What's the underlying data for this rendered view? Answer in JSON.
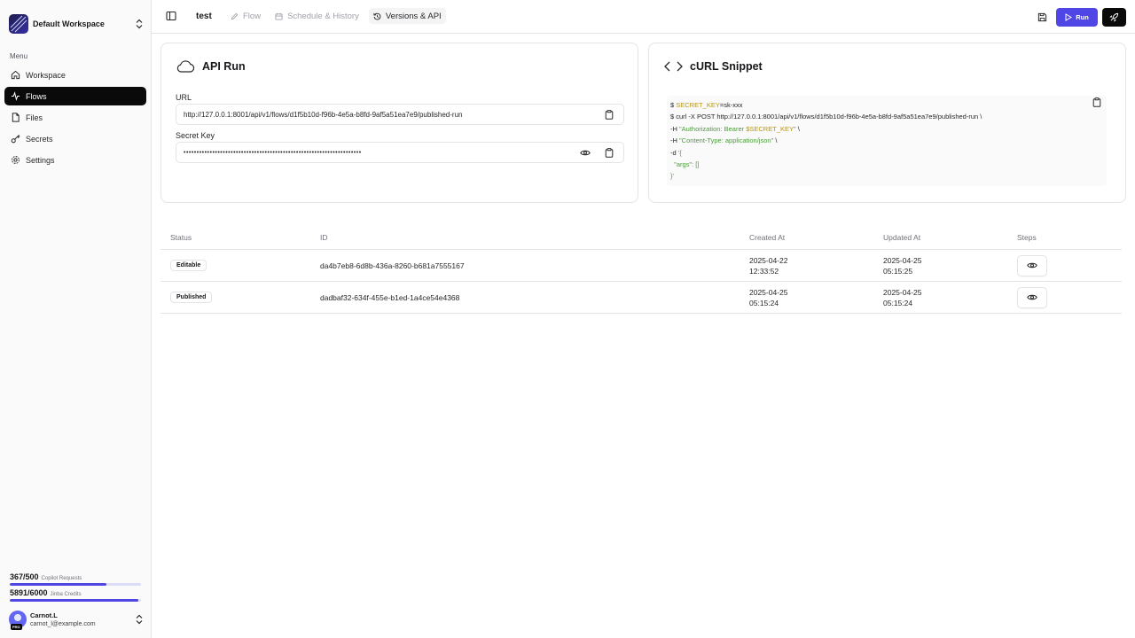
{
  "workspace": {
    "name": "Default Workspace"
  },
  "sidebar": {
    "menu_label": "Menu",
    "items": [
      {
        "label": "Workspace",
        "icon": "home-icon"
      },
      {
        "label": "Flows",
        "icon": "activity-icon",
        "active": true
      },
      {
        "label": "Files",
        "icon": "file-icon"
      },
      {
        "label": "Secrets",
        "icon": "key-icon"
      },
      {
        "label": "Settings",
        "icon": "gear-icon"
      }
    ],
    "usage": [
      {
        "value": "367/500",
        "label": "Copilot Requests",
        "fraction": 0.734
      },
      {
        "value": "5891/6000",
        "label": "Jinba Credits",
        "fraction": 0.982
      }
    ],
    "user": {
      "name": "Carnot.L",
      "email": "carnot_l@example.com",
      "badge": "PRO"
    }
  },
  "header": {
    "title": "test",
    "tabs": [
      {
        "label": "Flow",
        "icon": "pencil-icon"
      },
      {
        "label": "Schedule & History",
        "icon": "calendar-icon"
      },
      {
        "label": "Versions & API",
        "icon": "history-icon",
        "active": true
      }
    ],
    "run_label": "Run"
  },
  "api_card": {
    "title": "API Run",
    "url_label": "URL",
    "url_value": "http://127.0.0.1:8001/api/v1/flows/d1f5b10d-f96b-4e5a-b8fd-9af5a51ea7e9/published-run",
    "secret_label": "Secret Key",
    "secret_value": "••••••••••••••••••••••••••••••••••••••••••••••••••••••••••••••••••••"
  },
  "curl_card": {
    "title": "cURL Snippet",
    "lines": {
      "l1_prefix": "$ ",
      "l1_key": "SECRET_KEY",
      "l1_rest": "=sk-xxx",
      "l2": "$ curl -X POST http://127.0.0.1:8001/api/v1/flows/d1f5b10d-f96b-4e5a-b8fd-9af5a51ea7e9/published-run \\",
      "l3_prefix": "-H ",
      "l3_str": "\"Authorization: Bearer ",
      "l3_var": "$SECRET_KEY",
      "l3_end": "\"",
      "l3_tail": " \\",
      "l4_prefix": "-H ",
      "l4_str": "\"Content-Type: application/json\"",
      "l4_tail": " \\",
      "l5_prefix": "-d ",
      "l5_str": "'{",
      "l6_key": "\"args\"",
      "l6_rest": ": []",
      "l7": "}'"
    }
  },
  "versions_table": {
    "headers": {
      "status": "Status",
      "id": "ID",
      "created": "Created At",
      "updated": "Updated At",
      "steps": "Steps"
    },
    "rows": [
      {
        "status": "Editable",
        "id": "da4b7eb8-6d8b-436a-8260-b681a7555167",
        "created_date": "2025-04-22",
        "created_time": "12:33:52",
        "updated_date": "2025-04-25",
        "updated_time": "05:15:25"
      },
      {
        "status": "Published",
        "id": "dadbaf32-634f-455e-b1ed-1a4ce54e4368",
        "created_date": "2025-04-25",
        "created_time": "05:15:24",
        "updated_date": "2025-04-25",
        "updated_time": "05:15:24"
      }
    ]
  },
  "colors": {
    "accent": "#4f46e5",
    "dark": "#0a0a0a",
    "code_key": "#b7950b",
    "code_string": "#4d9a3c"
  }
}
